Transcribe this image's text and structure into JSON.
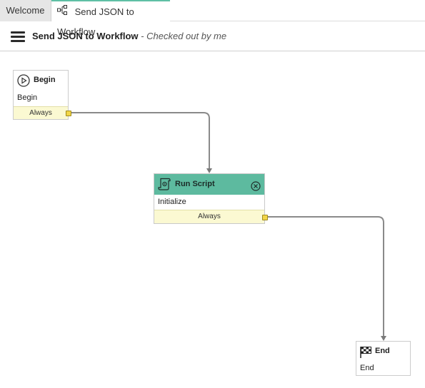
{
  "tabs": [
    {
      "label": "Welcome"
    },
    {
      "label": "Send JSON to Workflow",
      "icon": "workflow-icon"
    }
  ],
  "header": {
    "menu_icon": "hamburger-menu-icon",
    "title": "Send JSON to Workflow",
    "status": " - Checked out by me"
  },
  "canvas": {
    "nodes": {
      "begin": {
        "icon": "play-circle-icon",
        "title": "Begin",
        "body": "Begin",
        "condition": "Always"
      },
      "run_script": {
        "icon": "script-scroll-icon",
        "title": "Run Script",
        "body": "Initialize",
        "condition": "Always",
        "close_icon": "close-circle-icon"
      },
      "end": {
        "icon": "checkered-flag-icon",
        "title": "End",
        "body": "End"
      }
    }
  },
  "colors": {
    "accent": "#5dba9f",
    "condition_bg": "#fbf9d2",
    "port": "#f1d548",
    "connector": "#8a8a8a"
  }
}
